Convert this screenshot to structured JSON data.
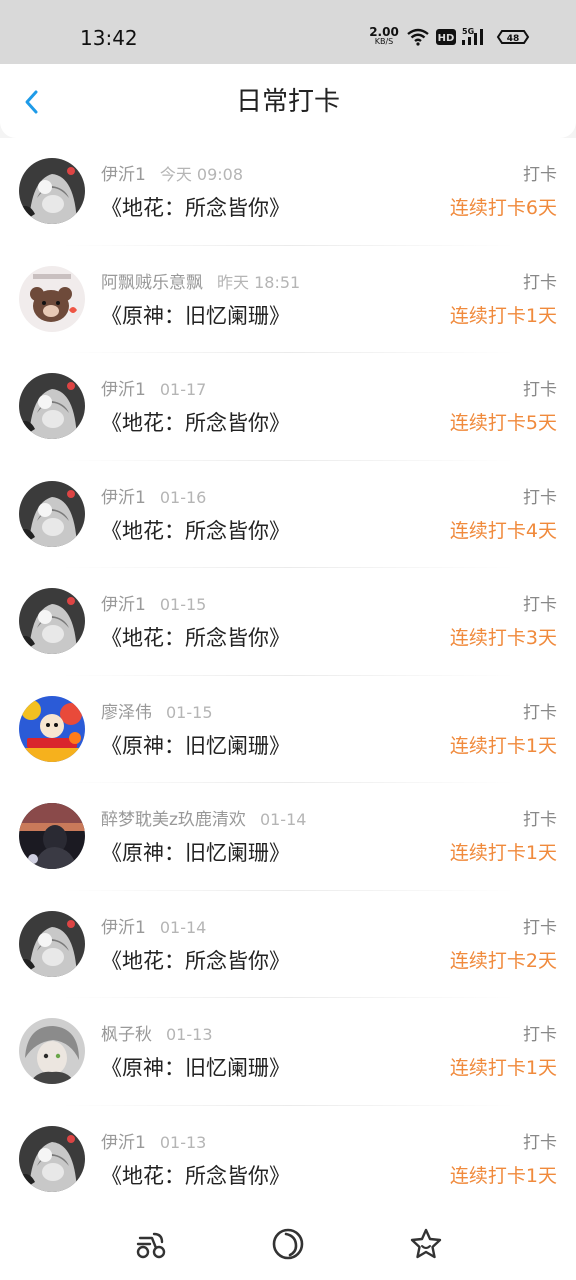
{
  "status": {
    "time": "13:42",
    "speed_value": "2.00",
    "speed_unit": "KB/S",
    "hd": "HD",
    "network": "5G",
    "battery": "48"
  },
  "header": {
    "title": "日常打卡"
  },
  "entries": [
    {
      "user": "伊沂1",
      "when": "今天 09:08",
      "book": "《地花：所念皆你》",
      "action": "打卡",
      "streak": "连续打卡6天",
      "avatar": "anime-girl"
    },
    {
      "user": "阿飘贼乐意飘",
      "when": "昨天 18:51",
      "book": "《原神：旧忆阑珊》",
      "action": "打卡",
      "streak": "连续打卡1天",
      "avatar": "bear"
    },
    {
      "user": "伊沂1",
      "when": "01-17",
      "book": "《地花：所念皆你》",
      "action": "打卡",
      "streak": "连续打卡5天",
      "avatar": "anime-girl"
    },
    {
      "user": "伊沂1",
      "when": "01-16",
      "book": "《地花：所念皆你》",
      "action": "打卡",
      "streak": "连续打卡4天",
      "avatar": "anime-girl"
    },
    {
      "user": "伊沂1",
      "when": "01-15",
      "book": "《地花：所念皆你》",
      "action": "打卡",
      "streak": "连续打卡3天",
      "avatar": "anime-girl"
    },
    {
      "user": "廖泽伟",
      "when": "01-15",
      "book": "《原神：旧忆阑珊》",
      "action": "打卡",
      "streak": "连续打卡1天",
      "avatar": "colorful"
    },
    {
      "user": "醉梦耽美z玖鹿清欢",
      "when": "01-14",
      "book": "《原神：旧忆阑珊》",
      "action": "打卡",
      "streak": "连续打卡1天",
      "avatar": "dark-scene"
    },
    {
      "user": "伊沂1",
      "when": "01-14",
      "book": "《地花：所念皆你》",
      "action": "打卡",
      "streak": "连续打卡2天",
      "avatar": "anime-girl"
    },
    {
      "user": "枫子秋",
      "when": "01-13",
      "book": "《原神：旧忆阑珊》",
      "action": "打卡",
      "streak": "连续打卡1天",
      "avatar": "anime-boy"
    },
    {
      "user": "伊沂1",
      "when": "01-13",
      "book": "《地花：所念皆你》",
      "action": "打卡",
      "streak": "连续打卡1天",
      "avatar": "anime-girl"
    }
  ],
  "tabbar": {
    "icons": [
      "scooter-icon",
      "moon-icon",
      "star-face-icon"
    ]
  },
  "colors": {
    "accent": "#1e9be8",
    "streak": "#f08a3c",
    "statusbar": "#d9d9d9"
  }
}
